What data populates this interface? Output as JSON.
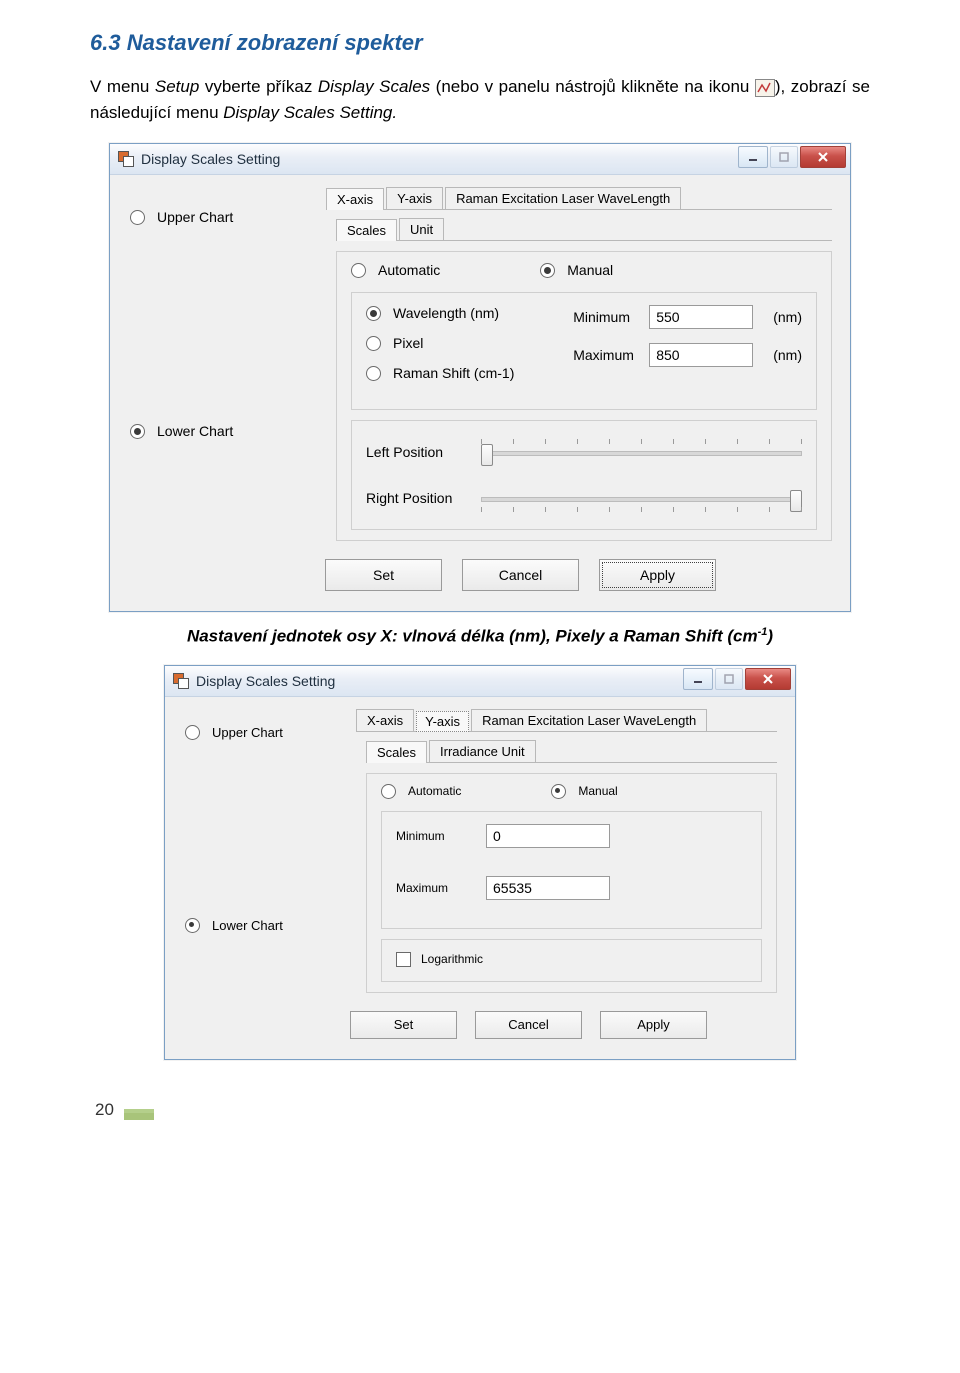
{
  "heading": "6.3 Nastavení zobrazení spekter",
  "intro": {
    "a": "V menu ",
    "setup": "Setup",
    "b": " vyberte příkaz ",
    "ds": "Display Scales",
    "c": " (nebo v panelu nástrojů klikněte na ikonu ",
    "d": "), zobrazí se následující menu ",
    "dss": "Display Scales Setting.",
    "e": ""
  },
  "caption1": {
    "prefix": "Nastavení jednotek osy X: vlnová délka (nm), Pixely a Raman Shift (cm",
    "sup": "-1",
    "suffix": ")"
  },
  "dlg1": {
    "title": "Display Scales Setting",
    "left": {
      "upper": "Upper Chart",
      "lower": "Lower Chart"
    },
    "tabs": {
      "x": "X-axis",
      "y": "Y-axis",
      "raman": "Raman Excitation Laser WaveLength"
    },
    "subtabs": {
      "scales": "Scales",
      "unit": "Unit"
    },
    "auto": "Automatic",
    "manual": "Manual",
    "units": {
      "wl": "Wavelength (nm)",
      "px": "Pixel",
      "rs": "Raman Shift (cm-1)"
    },
    "min": {
      "label": "Minimum",
      "value": "550",
      "unit": "(nm)"
    },
    "max": {
      "label": "Maximum",
      "value": "850",
      "unit": "(nm)"
    },
    "leftpos": "Left Position",
    "rightpos": "Right Position",
    "btns": {
      "set": "Set",
      "cancel": "Cancel",
      "apply": "Apply"
    }
  },
  "dlg2": {
    "title": "Display Scales Setting",
    "left": {
      "upper": "Upper Chart",
      "lower": "Lower Chart"
    },
    "tabs": {
      "x": "X-axis",
      "y": "Y-axis",
      "raman": "Raman Excitation Laser WaveLength"
    },
    "subtabs": {
      "scales": "Scales",
      "irr": "Irradiance Unit"
    },
    "auto": "Automatic",
    "manual": "Manual",
    "min": {
      "label": "Minimum",
      "value": "0"
    },
    "max": {
      "label": "Maximum",
      "value": "65535"
    },
    "log": "Logarithmic",
    "btns": {
      "set": "Set",
      "cancel": "Cancel",
      "apply": "Apply"
    }
  },
  "pagenum": "20"
}
